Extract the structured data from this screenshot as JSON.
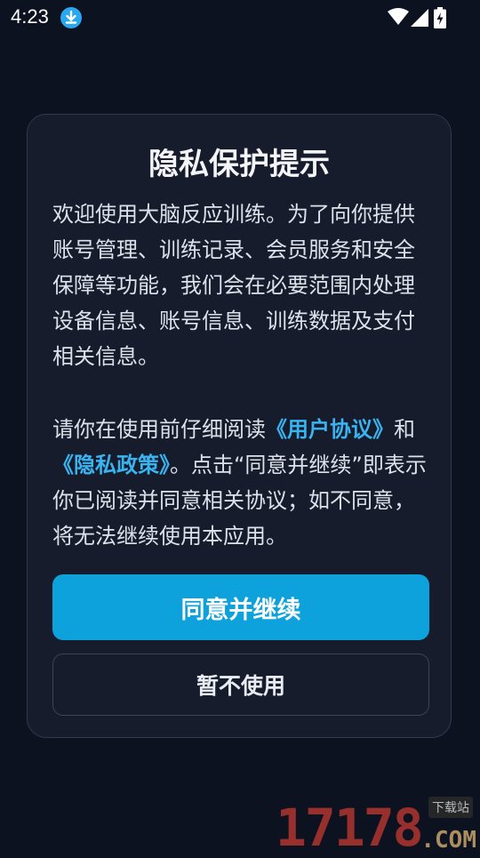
{
  "status_bar": {
    "time": "4:23"
  },
  "dialog": {
    "title": "隐私保护提示",
    "paragraph1": "欢迎使用大脑反应训练。为了向你提供账号管理、训练记录、会员服务和安全保障等功能，我们会在必要范围内处理设备信息、账号信息、训练数据及支付相关信息。",
    "paragraph2": {
      "prefix": "请你在使用前仔细阅读",
      "user_agreement_link": "《用户协议》",
      "middle": "和",
      "privacy_policy_link": "《隐私政策》",
      "suffix": "。点击“同意并继续”即表示你已阅读并同意相关协议；如不同意，将无法继续使用本应用。"
    },
    "agree_button": "同意并继续",
    "decline_button": "暂不使用"
  },
  "watermark": {
    "digits": "17178",
    "domain": ".COM",
    "label": "下载站"
  },
  "colors": {
    "background": "#0c1220",
    "dialog_bg": "#161c2c",
    "accent": "#0ea2dc",
    "link": "#3ab4f0"
  },
  "icons": [
    "download-icon",
    "wifi-icon",
    "signal-icon",
    "battery-charging-icon"
  ]
}
